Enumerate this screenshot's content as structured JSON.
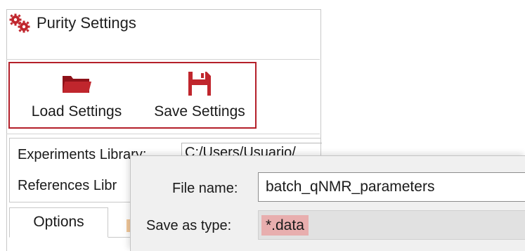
{
  "window": {
    "title": "Purity Settings",
    "title_icon": "gears-icon"
  },
  "toolbar": {
    "load_label": "Load Settings",
    "load_icon": "folder-icon",
    "save_label": "Save Settings",
    "save_icon": "floppy-disk-icon",
    "highlight_color": "#b4202a"
  },
  "panel": {
    "experiments_label": "Experiments Library:",
    "experiments_path": "C:/Users/Usuario/",
    "references_label": "References Libr"
  },
  "tabs": [
    {
      "label": "Options",
      "active": true
    }
  ],
  "dialog": {
    "file_name_label": "File name:",
    "file_name_value": "batch_qNMR_parameters",
    "save_type_label": "Save as type:",
    "save_type_value": "*.data",
    "save_type_highlight": "#e8aeae"
  },
  "colors": {
    "icon_red": "#c0262d",
    "folder_dark_red": "#8e1219"
  }
}
